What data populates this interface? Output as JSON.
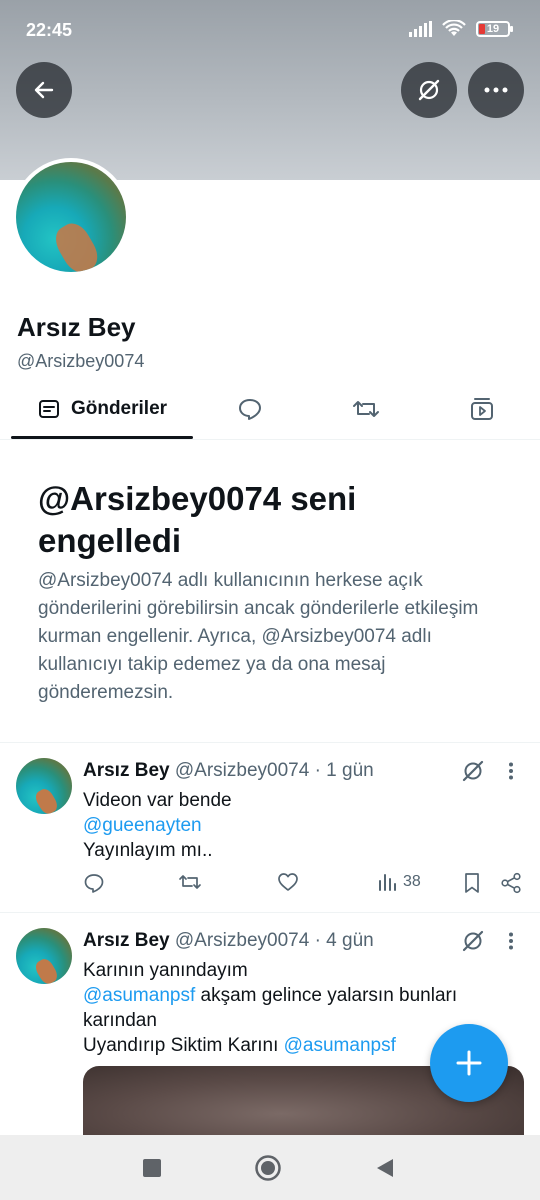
{
  "status_bar": {
    "time": "22:45",
    "battery": "19"
  },
  "profile": {
    "name": "Arsız Bey",
    "handle": "@Arsizbey0074"
  },
  "tabs": [
    {
      "label": "Gönderiler",
      "icon": "posts-icon",
      "active": true
    },
    {
      "label": "",
      "icon": "reply-bubble-icon"
    },
    {
      "label": "",
      "icon": "repost-icon"
    },
    {
      "label": "",
      "icon": "media-icon"
    }
  ],
  "blocked": {
    "title": "@Arsizbey0074 seni engelledi",
    "description": "@Arsizbey0074 adlı kullanıcının herkese açık gönderilerini görebilirsin ancak gönderilerle etkileşim kurman engellenir. Ayrıca, @Arsizbey0074 adlı kullanıcıyı takip edemez ya da ona mesaj gönderemezsin."
  },
  "tweets": [
    {
      "name": "Arsız Bey",
      "meta": "@Arsizbey0074 · 1 gün",
      "line1": "Videon var bende",
      "mention1": "@gueenayten",
      "line3": "Yayınlayım mı..",
      "views": "38"
    },
    {
      "name": "Arsız Bey",
      "meta": "@Arsizbey0074 · 4 gün",
      "line1": "Karının yanındayım",
      "mention1": "@asumanpsf",
      "line2_rest": " akşam gelince yalarsın bunları karından",
      "line3": "Uyandırıp Siktim Karını ",
      "mention2": "@asumanpsf"
    }
  ],
  "colors": {
    "accent": "#1d9bf0",
    "text": "#0f1419",
    "muted": "#536471"
  }
}
